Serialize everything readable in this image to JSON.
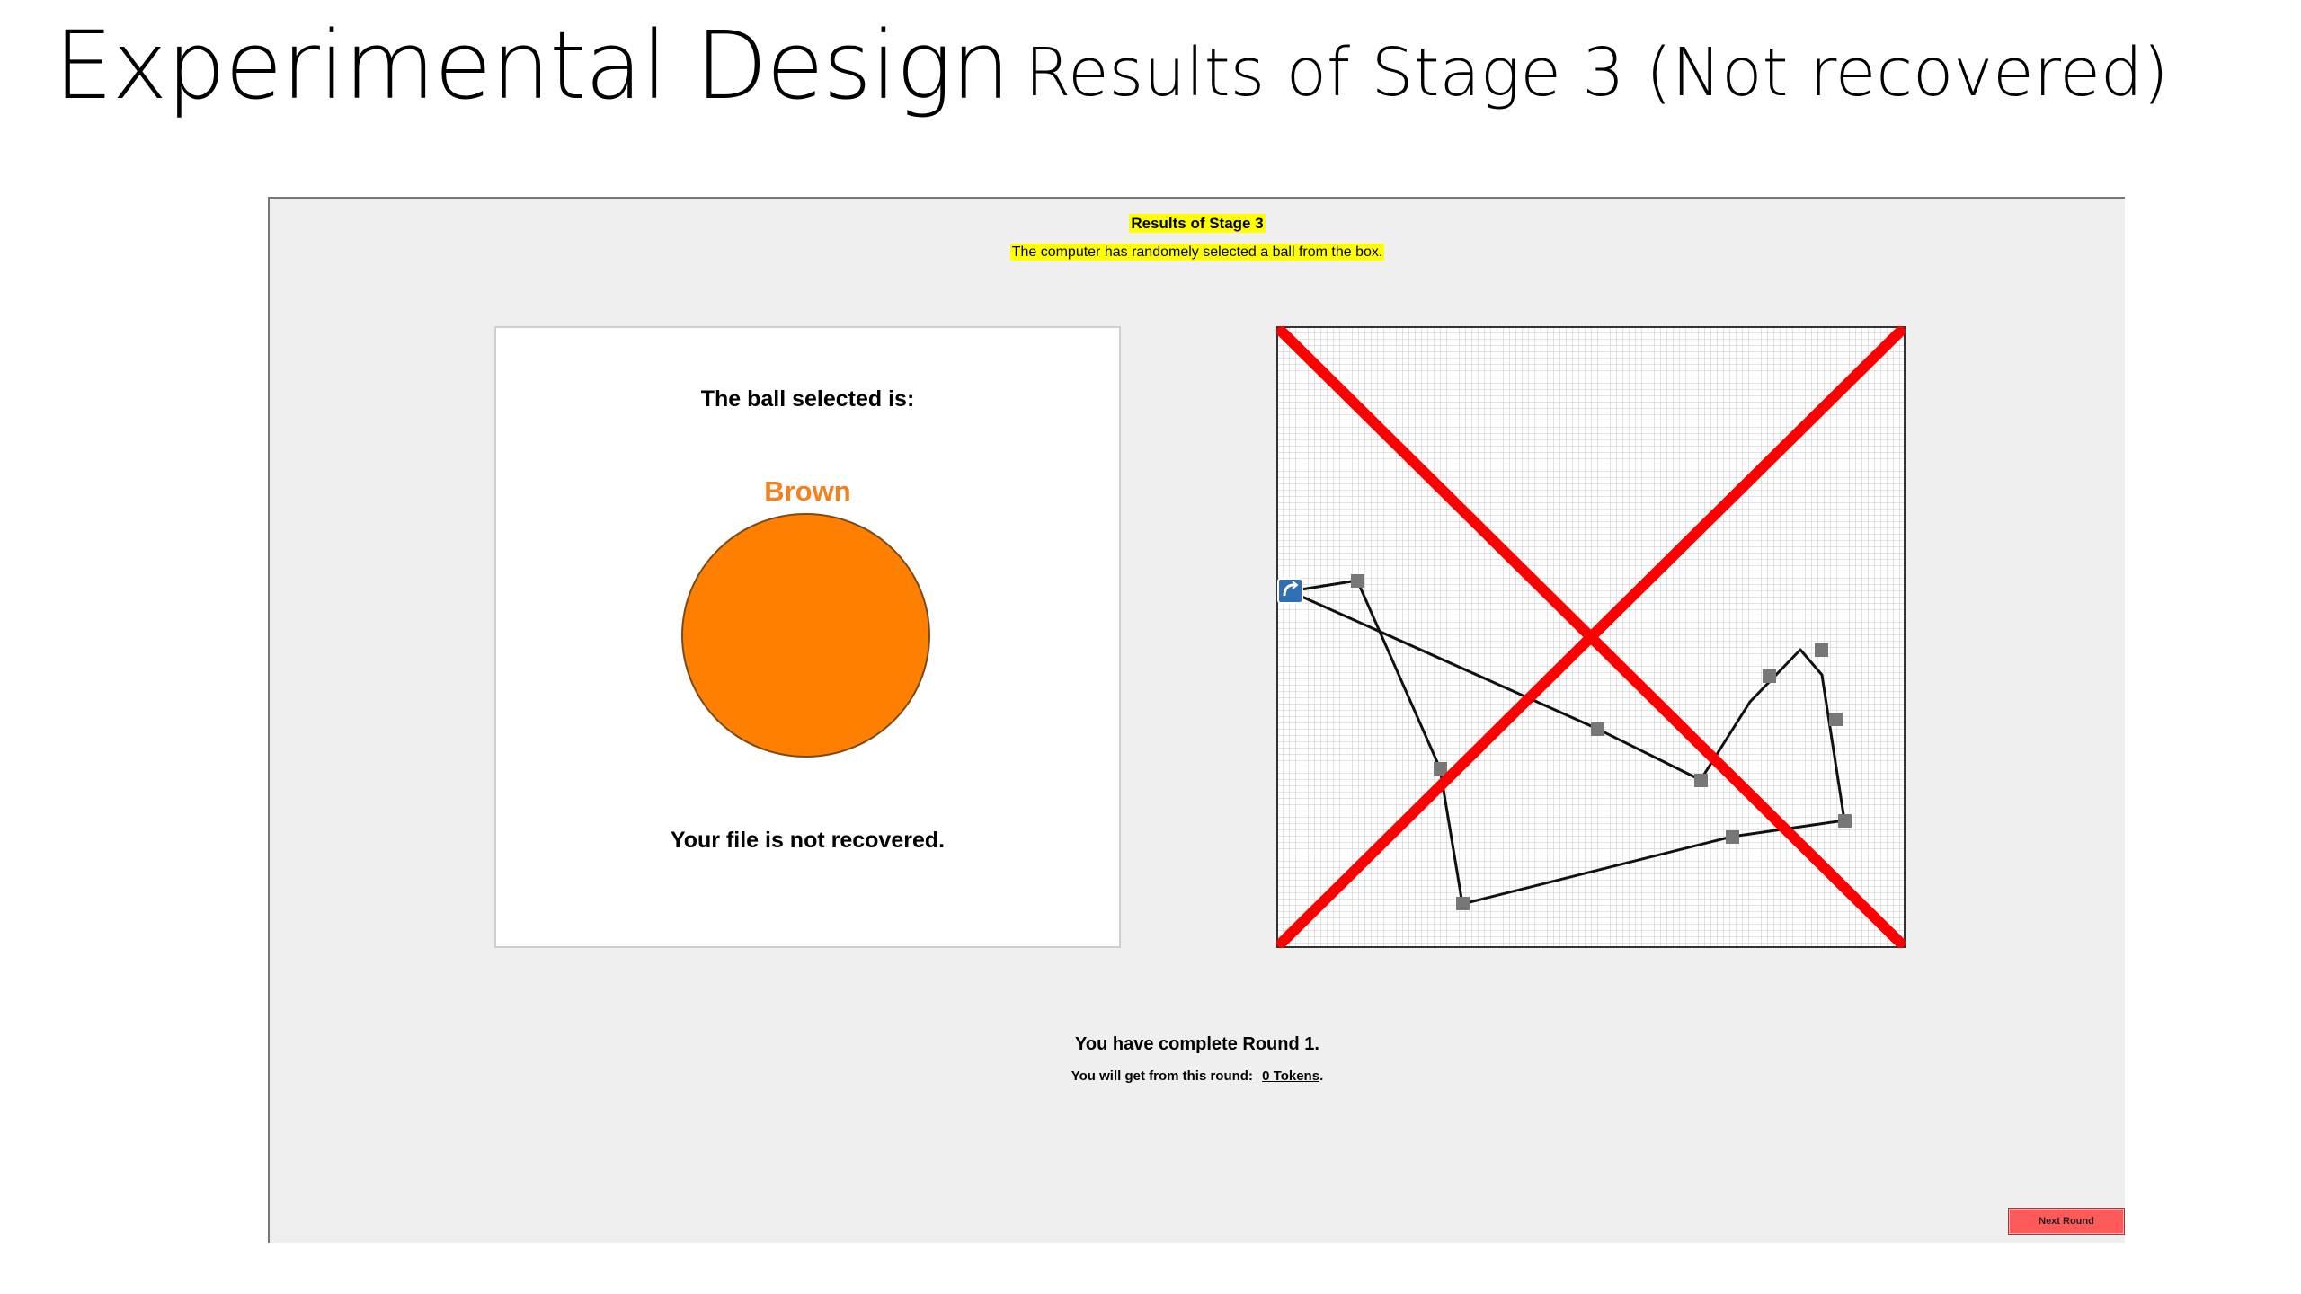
{
  "slide": {
    "title": "Experimental Design",
    "subtitle": "Results of Stage 3 (Not recovered)"
  },
  "screen": {
    "heading": "Results of Stage 3",
    "note": "The computer has randomely selected a ball from the box.",
    "ball_panel": {
      "label": "The ball selected is:",
      "color_name": "Brown",
      "ball_color": "#ff8000",
      "color_name_color": "#f4801f",
      "result": "Your file is not recovered."
    },
    "grid_panel": {
      "icon": "cursor-start-icon",
      "cross_color": "#ff0000",
      "marker_color": "#777777"
    },
    "round_message": "You have complete Round 1.",
    "earn_label": "You will get from this round:",
    "earn_value": "0 Tokens",
    "earn_suffix": ".",
    "next_button": "Next Round"
  }
}
